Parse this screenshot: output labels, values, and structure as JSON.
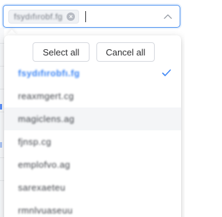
{
  "select": {
    "tag_text": "fsydıfırobf.fg",
    "tag_close_glyph": "×"
  },
  "dropdown": {
    "select_all_label": "Select all",
    "cancel_all_label": "Cancel all",
    "options": [
      {
        "text": "fsydıfırobfı.fg",
        "selected": true
      },
      {
        "text": "reaxmgert.cg",
        "selected": false
      },
      {
        "text": "magiclens.ag",
        "selected": false
      },
      {
        "text": "fjnsp.cg",
        "selected": false
      },
      {
        "text": "emplofvo.ag",
        "selected": false
      },
      {
        "text": "sarexaeteu",
        "selected": false
      },
      {
        "text": "rmnlvuaseuu",
        "selected": false
      }
    ]
  },
  "icons": {
    "chevron": "chevron-up-icon",
    "check": "check-icon",
    "tag_close": "close-circle-icon"
  },
  "colors": {
    "accent": "#3f87f5",
    "border_focus": "#4c91f0",
    "hover_bg": "#f4f5f7"
  }
}
